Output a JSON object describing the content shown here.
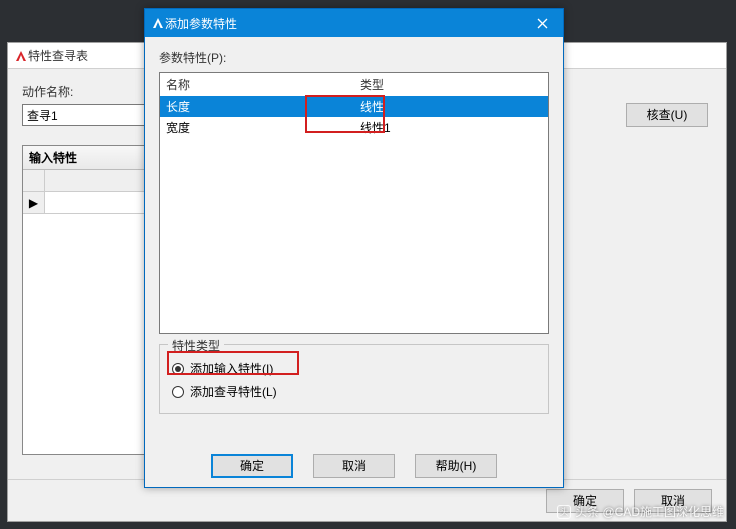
{
  "bg": {
    "title": "特性查寻表",
    "action_label": "动作名称:",
    "action_value": "查寻1",
    "check_btn": "核查(U)",
    "panel_header": "输入特性",
    "row_marker": "▶",
    "ok": "确定",
    "cancel": "取消"
  },
  "modal": {
    "title": "添加参数特性",
    "param_label": "参数特性(P):",
    "col_name": "名称",
    "col_type": "类型",
    "rows": [
      {
        "name": "长度",
        "type": "线性"
      },
      {
        "name": "宽度",
        "type": "线性1"
      }
    ],
    "group_title": "特性类型",
    "radio_input": "添加输入特性(I)",
    "radio_lookup": "添加查寻特性(L)",
    "ok": "确定",
    "cancel": "取消",
    "help": "帮助(H)"
  },
  "watermark": "头条 @CAD施工图深化思维"
}
